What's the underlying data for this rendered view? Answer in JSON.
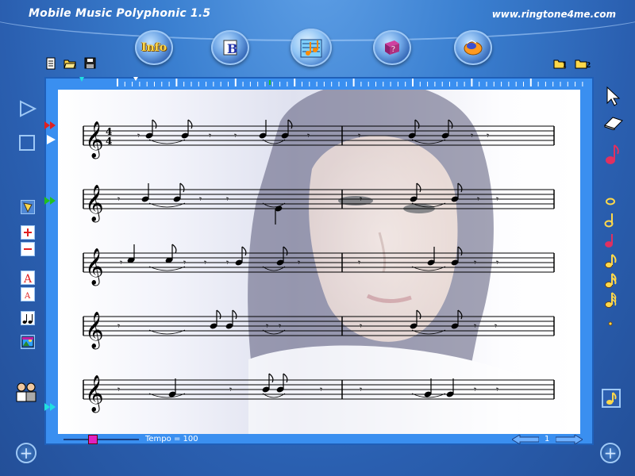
{
  "header": {
    "title": "Mobile Music Polyphonic 1.5",
    "url": "www.ringtone4me.com"
  },
  "toolbar": {
    "info_label": "Info",
    "buttons": [
      "info",
      "instrument",
      "score",
      "help",
      "about"
    ]
  },
  "status": {
    "tempo_text": "Tempo = 100",
    "page_number": "1"
  },
  "colors": {
    "accent": "#3a8ff0",
    "slider_knob": "#e020c0",
    "note_yellow": "#ffd84a",
    "marker_red": "#e02020",
    "marker_green": "#20c020",
    "marker_cyan": "#20e0e0"
  },
  "score": {
    "time_signature": "4/4",
    "staff_count": 5
  }
}
